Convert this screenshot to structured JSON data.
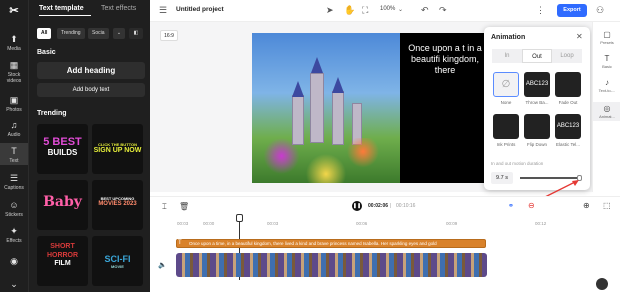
{
  "rail": {
    "items": [
      {
        "label": "Media",
        "icon": "media-icon"
      },
      {
        "label": "Stock videos",
        "icon": "stock-videos-icon"
      },
      {
        "label": "Photos",
        "icon": "photos-icon"
      },
      {
        "label": "Audio",
        "icon": "audio-icon"
      },
      {
        "label": "Text",
        "icon": "text-icon"
      },
      {
        "label": "Captions",
        "icon": "captions-icon"
      },
      {
        "label": "Stickers",
        "icon": "stickers-icon"
      },
      {
        "label": "Effects",
        "icon": "effects-icon"
      }
    ]
  },
  "panel": {
    "tab_template": "Text template",
    "tab_effects": "Text effects",
    "chips": [
      "All",
      "Trending",
      "Socia"
    ],
    "basic_title": "Basic",
    "add_heading": "Add heading",
    "add_body": "Add body text",
    "trending_title": "Trending",
    "tiles": [
      {
        "line1": "5 BEST",
        "line2": "BUILDS",
        "color": "#e14cd6"
      },
      {
        "line1": "CLICK THE BUTTON",
        "line2": "SIGN UP NOW",
        "color": "#e7f03a"
      },
      {
        "line1": "Baby",
        "line2": "",
        "color": "#ff5fa8"
      },
      {
        "line1": "BEST UPCOMING",
        "line2": "MOVIES 2023",
        "color": "#ff5a3c"
      },
      {
        "line1": "SHORT HORROR",
        "line2": "FILM",
        "color": "#d83a3a"
      },
      {
        "line1": "SCI-FI",
        "line2": "MOVIE",
        "color": "#3aa6d8"
      }
    ]
  },
  "top": {
    "project_title": "Untitled project",
    "zoom": "100%",
    "export": "Export"
  },
  "canvas": {
    "ratio": "16:9",
    "caption": "Once upon a t in a beautifi kingdom, there"
  },
  "animation": {
    "title": "Animation",
    "tabs": [
      "In",
      "Out",
      "Loop"
    ],
    "active_tab": "Out",
    "options": [
      {
        "label": "None",
        "thumb": "∅"
      },
      {
        "label": "Throw Ba...",
        "thumb": "ABC123"
      },
      {
        "label": "Fade Out",
        "thumb": ""
      },
      {
        "label": "Ink Prints",
        "thumb": ""
      },
      {
        "label": "Flip Down",
        "thumb": ""
      },
      {
        "label": "Elastic Tel...",
        "thumb": "ABC123"
      }
    ],
    "duration_label": "In and out motion duration",
    "duration_value": "9.7 s",
    "duration_fraction": 0.97
  },
  "right_rail": {
    "items": [
      {
        "label": "Presets",
        "icon": "presets-icon"
      },
      {
        "label": "Basic",
        "icon": "basic-icon"
      },
      {
        "label": "Text-to-...",
        "icon": "text-to-speech-icon"
      },
      {
        "label": "Animat...",
        "icon": "animation-icon"
      }
    ]
  },
  "timeline": {
    "current_time": "00:02:06",
    "total_time": "00:10:16",
    "ticks": [
      "00:03",
      "00:06",
      "00:09",
      "00:12"
    ],
    "text_track": "Once upon a time, in a beautiful kingdom, there lived a kind and brave princess named Isabella. Her sparkling eyes and gold"
  },
  "colors": {
    "accent": "#2f6bff",
    "text_track": "#d9822b",
    "annotation_arrow": "#e53935"
  }
}
